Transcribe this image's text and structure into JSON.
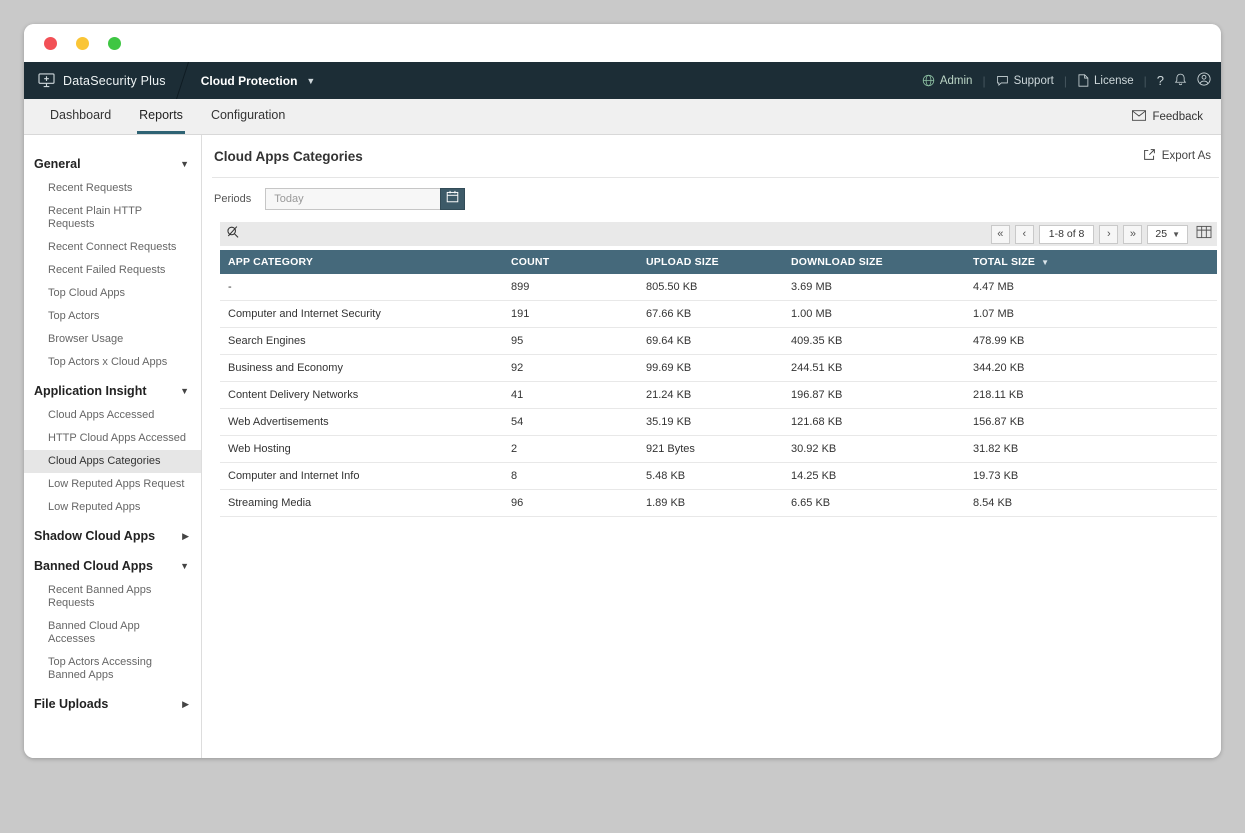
{
  "colors": {
    "topbar_bg": "#1c2d36",
    "subnav_bg": "#f0f0f0",
    "table_header_bg": "#45697b",
    "tab_underline": "#2e6374",
    "toolbar_bg": "#e9e9e9",
    "calendar_btn_bg": "#3d5a68",
    "selected_item_bg": "#e6e6e6",
    "dot_red": "#f25056",
    "dot_yellow": "#fac536",
    "dot_green": "#3ec643"
  },
  "topbar": {
    "brand": "DataSecurity Plus",
    "module": "Cloud Protection",
    "links": {
      "admin": "Admin",
      "support": "Support",
      "license": "License",
      "help": "?"
    }
  },
  "nav": {
    "tabs": [
      "Dashboard",
      "Reports",
      "Configuration"
    ],
    "active_tab": "Reports",
    "feedback_label": "Feedback"
  },
  "sidebar": {
    "selected": "Cloud Apps Categories",
    "sections": [
      {
        "label": "General",
        "expanded": true,
        "items": [
          "Recent Requests",
          "Recent Plain HTTP Requests",
          "Recent Connect Requests",
          "Recent Failed Requests",
          "Top Cloud Apps",
          "Top Actors",
          "Browser Usage",
          "Top Actors x Cloud Apps"
        ]
      },
      {
        "label": "Application Insight",
        "expanded": true,
        "items": [
          "Cloud Apps Accessed",
          "HTTP Cloud Apps Accessed",
          "Cloud Apps Categories",
          "Low Reputed Apps Request",
          "Low Reputed Apps"
        ]
      },
      {
        "label": "Shadow Cloud Apps",
        "expanded": false,
        "items": []
      },
      {
        "label": "Banned Cloud Apps",
        "expanded": true,
        "items": [
          "Recent Banned Apps Requests",
          "Banned Cloud App Accesses",
          "Top Actors Accessing Banned Apps"
        ]
      },
      {
        "label": "File Uploads",
        "expanded": false,
        "items": []
      }
    ]
  },
  "main": {
    "title": "Cloud Apps Categories",
    "export_label": "Export As",
    "periods": {
      "label": "Periods",
      "value": "Today"
    },
    "pager": {
      "first": "«",
      "prev": "‹",
      "range": "1-8 of 8",
      "next": "›",
      "last": "»",
      "page_size": "25"
    },
    "table": {
      "columns": [
        "APP CATEGORY",
        "COUNT",
        "UPLOAD SIZE",
        "DOWNLOAD SIZE",
        "TOTAL SIZE"
      ],
      "sort_column": "TOTAL SIZE",
      "rows": [
        [
          "-",
          "899",
          "805.50 KB",
          "3.69 MB",
          "4.47 MB"
        ],
        [
          "Computer and Internet Security",
          "191",
          "67.66 KB",
          "1.00 MB",
          "1.07 MB"
        ],
        [
          "Search Engines",
          "95",
          "69.64 KB",
          "409.35 KB",
          "478.99 KB"
        ],
        [
          "Business and Economy",
          "92",
          "99.69 KB",
          "244.51 KB",
          "344.20 KB"
        ],
        [
          "Content Delivery Networks",
          "41",
          "21.24 KB",
          "196.87 KB",
          "218.11 KB"
        ],
        [
          "Web Advertisements",
          "54",
          "35.19 KB",
          "121.68 KB",
          "156.87 KB"
        ],
        [
          "Web Hosting",
          "2",
          "921 Bytes",
          "30.92 KB",
          "31.82 KB"
        ],
        [
          "Computer and Internet Info",
          "8",
          "5.48 KB",
          "14.25 KB",
          "19.73 KB"
        ],
        [
          "Streaming Media",
          "96",
          "1.89 KB",
          "6.65 KB",
          "8.54 KB"
        ]
      ]
    }
  }
}
